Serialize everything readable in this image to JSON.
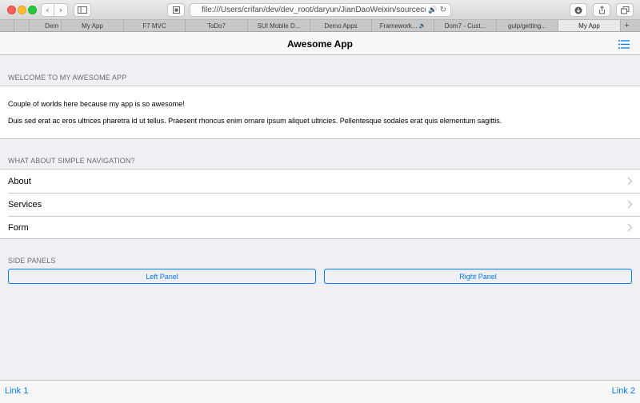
{
  "browser": {
    "url": "file:///Users/crifan/dev/dev_root/daryun/JianDaoWeixin/sourcecode/UID",
    "tabs": [
      {
        "label": "",
        "active": false
      },
      {
        "label": "",
        "active": false
      },
      {
        "label": "Dem",
        "active": false
      },
      {
        "label": "My App",
        "active": false
      },
      {
        "label": "F7 MVC",
        "active": false
      },
      {
        "label": "ToDo7",
        "active": false
      },
      {
        "label": "SUI Mobile D...",
        "active": false
      },
      {
        "label": "Demo Apps",
        "active": false
      },
      {
        "label": "Framework...",
        "active": false
      },
      {
        "label": "Dom7 - Cust...",
        "active": false
      },
      {
        "label": "gulp/getting...",
        "active": false
      },
      {
        "label": "My App",
        "active": true
      }
    ],
    "add_tab": "+"
  },
  "navbar": {
    "title": "Awesome App",
    "menu_icon": "list-icon"
  },
  "welcome": {
    "title": "Welcome to my awesome app",
    "line1": "Couple of worlds here because my app is so awesome!",
    "line2": "Duis sed erat ac eros ultrices pharetra id ut tellus. Praesent rhoncus enim ornare ipsum aliquet ultricies. Pellentesque sodales erat quis elementum sagittis."
  },
  "navigation": {
    "title": "What about simple navigation?",
    "items": [
      {
        "label": "About"
      },
      {
        "label": "Services"
      },
      {
        "label": "Form"
      }
    ]
  },
  "side_panels": {
    "title": "Side panels",
    "left_label": "Left Panel",
    "right_label": "Right Panel"
  },
  "toolbar": {
    "link1": "Link 1",
    "link2": "Link 2"
  },
  "colors": {
    "accent": "#007aff",
    "background": "#efeff4"
  }
}
